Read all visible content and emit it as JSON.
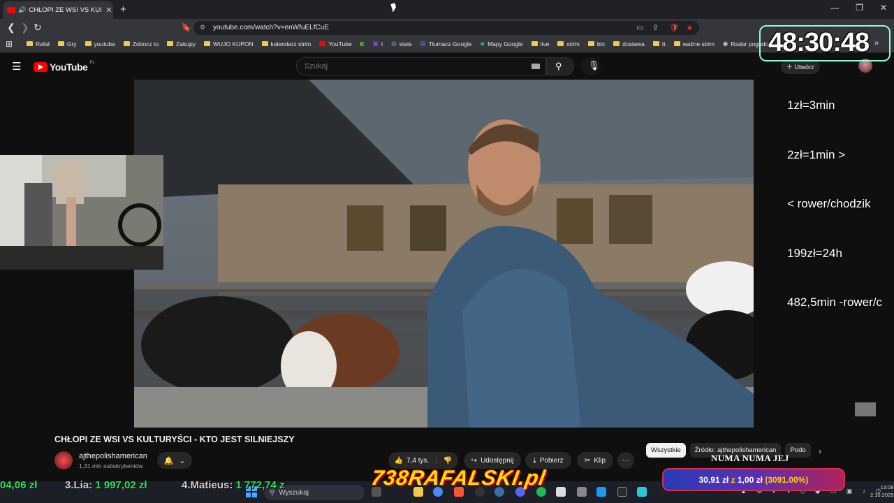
{
  "browser": {
    "tab_title": "CHŁOPI ZE WSI VS KULTURYŚ",
    "url": "youtube.com/watch?v=enWfuELfCuE",
    "bookmarks": [
      "Rafał",
      "Gry",
      "youtube",
      "Zobocz to",
      "Zakupy",
      "WUJO KUPON",
      "kalendarz strim",
      "YouTube",
      "t",
      "stats",
      "Tłumacz Google",
      "Mapy Google",
      "live",
      "strim",
      "btc",
      "dostawa",
      "tt",
      "ważne strim",
      "Radar pogodowy"
    ]
  },
  "youtube": {
    "logo_text": "YouTube",
    "logo_country": "PL",
    "search_placeholder": "Szukaj",
    "create_label": "Utwórz",
    "video_title": "CHŁOPI ZE WSI VS KULTURYŚCI - KTO JEST SILNIEJSZY",
    "channel_name": "ajthepolishamerican",
    "channel_subs": "1,31 mln subskrybentów",
    "likes": "7,4 tys.",
    "share_label": "Udostępnij",
    "download_label": "Pobierz",
    "clip_label": "Klip",
    "chips": [
      "Wszystkie",
      "Źródło: ajthepolishamerican",
      "Podo"
    ]
  },
  "stream_overlay": {
    "timer": "48:30:48",
    "rules": [
      "1zł=3min",
      "2zł=1min >",
      "< rower/chodzik",
      "199zł=24h",
      "482,5min -rower/c"
    ],
    "leaderboard": [
      {
        "name": "",
        "amount": "04,06 zł"
      },
      {
        "name": "3.Lia:",
        "amount": "1 997,02 zł"
      },
      {
        "name": "4.Matieus:",
        "amount": "1 772,74 z"
      }
    ],
    "brand": "738RAFALSKI.pl",
    "now_playing": "NUMA NUMA JEJ",
    "donation_main": "30,91 zł",
    "donation_sep": "z",
    "donation_base": "1,00 zł",
    "donation_pct": "(3091.00%)"
  },
  "taskbar": {
    "search_placeholder": "Wyszukaj",
    "time": "13:08",
    "date": "2.10.2025"
  }
}
